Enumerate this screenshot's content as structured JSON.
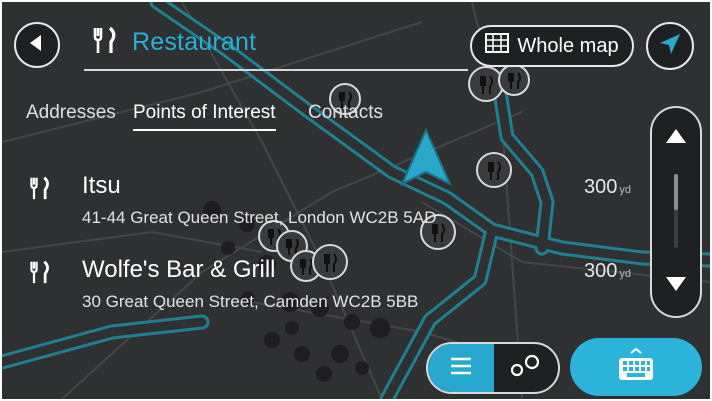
{
  "search": {
    "query": "Restaurant",
    "icon": "fork-knife-icon"
  },
  "toolbar": {
    "whole_map_label": "Whole map"
  },
  "tabs": [
    {
      "label": "Addresses"
    },
    {
      "label": "Points of Interest",
      "selected": true
    },
    {
      "label": "Contacts"
    }
  ],
  "results": [
    {
      "name": "Itsu",
      "address": "41-44 Great Queen Street, London WC2B 5AD",
      "distance": "300",
      "unit": "yd"
    },
    {
      "name": "Wolfe's Bar & Grill",
      "address": "30 Great Queen Street, Camden WC2B 5BB",
      "distance": "300",
      "unit": "yd"
    }
  ],
  "colors": {
    "accent": "#27b0d8",
    "background": "#2f3032",
    "road": "#2a8ea5",
    "button": "#1f2022"
  }
}
